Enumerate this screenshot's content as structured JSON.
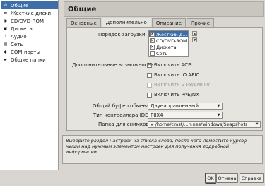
{
  "sidebar": {
    "items": [
      {
        "label": "Общие",
        "icon": "gear-icon",
        "selected": true
      },
      {
        "label": "Жесткие диски",
        "icon": "hard-disk-icon",
        "selected": false
      },
      {
        "label": "CD/DVD-ROM",
        "icon": "cd-rom-icon",
        "selected": false
      },
      {
        "label": "Дискета",
        "icon": "floppy-icon",
        "selected": false
      },
      {
        "label": "Аудио",
        "icon": "audio-icon",
        "selected": false
      },
      {
        "label": "Сеть",
        "icon": "network-icon",
        "selected": false
      },
      {
        "label": "COM-порты",
        "icon": "com-port-icon",
        "selected": false
      },
      {
        "label": "Общие папки",
        "icon": "shared-folder-icon",
        "selected": false
      }
    ]
  },
  "header": {
    "title": "Общие"
  },
  "tabs": [
    {
      "label": "Основные",
      "active": false
    },
    {
      "label": "Дополнительно",
      "active": true
    },
    {
      "label": "Описание",
      "active": false
    },
    {
      "label": "Прочие",
      "active": false
    }
  ],
  "advanced": {
    "boot_order_label": "Порядок загрузки:",
    "boot_order": [
      {
        "label": "Жесткий д...",
        "checked": true,
        "selected": true
      },
      {
        "label": "CD/DVD-ROM",
        "checked": true,
        "selected": false
      },
      {
        "label": "Дискета",
        "checked": true,
        "selected": false
      },
      {
        "label": "Сеть",
        "checked": false,
        "selected": false
      }
    ],
    "features_label": "Дополнительные возможности:",
    "features": [
      {
        "label": "Включить ACPI",
        "checked": true,
        "disabled": false
      },
      {
        "label": "Включить IO APIC",
        "checked": false,
        "disabled": false
      },
      {
        "label": "Включить VT-x/AMD-V",
        "checked": false,
        "disabled": true
      },
      {
        "label": "Включить PAE/NX",
        "checked": false,
        "disabled": false
      }
    ],
    "clipboard_label": "Общий буфер обмена:",
    "clipboard_value": "Двунаправленный",
    "ide_label": "Тип контроллера IDE:",
    "ide_value": "PIIX4",
    "snapshots_label": "Папка для снимков:",
    "snapshots_value": "/home/cmst/...hines/windows/Snapshots"
  },
  "hint": "Выберите раздел настроек из списка слева, после чего поместите курсор мыши над нужным элементом настроек для получения подробной информации.",
  "buttons": {
    "ok": "OK",
    "cancel": "Отмена",
    "help": "Справка"
  }
}
